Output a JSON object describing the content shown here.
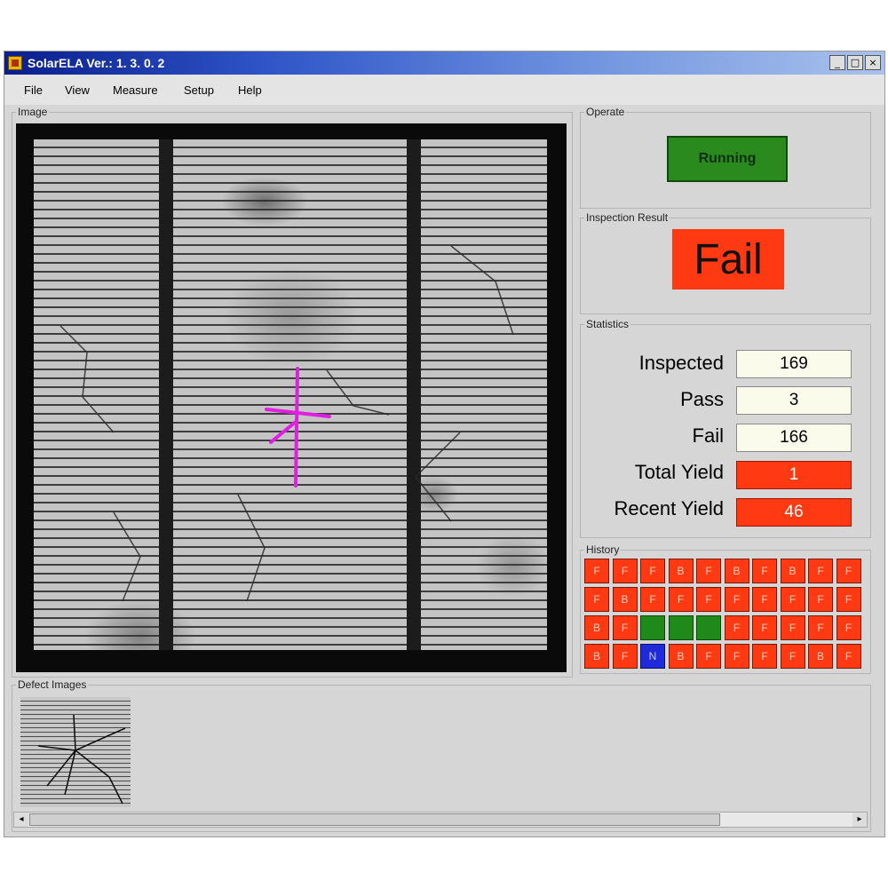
{
  "window": {
    "title": "SolarELA Ver.: 1. 3. 0. 2",
    "controls": {
      "minimize": "_",
      "maximize": "□",
      "close": "×"
    }
  },
  "menu": [
    "File",
    "View",
    "Measure",
    "Setup",
    "Help"
  ],
  "image_panel": {
    "label": "Image"
  },
  "operate": {
    "label": "Operate",
    "status_button": "Running",
    "status_color": "#2a8a1e"
  },
  "inspection_result": {
    "label": "Inspection Result",
    "value": "Fail",
    "color": "#ff3a12"
  },
  "statistics": {
    "label": "Statistics",
    "rows": [
      {
        "label": "Inspected",
        "value": "169",
        "style": "white"
      },
      {
        "label": "Pass",
        "value": "3",
        "style": "white"
      },
      {
        "label": "Fail",
        "value": "166",
        "style": "white"
      },
      {
        "label": "Total Yield",
        "value": "1",
        "style": "red"
      },
      {
        "label": "Recent Yield",
        "value": "46",
        "style": "red"
      }
    ]
  },
  "history": {
    "label": "History",
    "cells": [
      {
        "t": "F",
        "s": "fail"
      },
      {
        "t": "F",
        "s": "fail"
      },
      {
        "t": "F",
        "s": "fail"
      },
      {
        "t": "B",
        "s": "fail"
      },
      {
        "t": "F",
        "s": "fail"
      },
      {
        "t": "B",
        "s": "fail"
      },
      {
        "t": "F",
        "s": "fail"
      },
      {
        "t": "B",
        "s": "fail"
      },
      {
        "t": "F",
        "s": "fail"
      },
      {
        "t": "F",
        "s": "fail"
      },
      {
        "t": "F",
        "s": "fail"
      },
      {
        "t": "B",
        "s": "fail"
      },
      {
        "t": "F",
        "s": "fail"
      },
      {
        "t": "F",
        "s": "fail"
      },
      {
        "t": "F",
        "s": "fail"
      },
      {
        "t": "F",
        "s": "fail"
      },
      {
        "t": "F",
        "s": "fail"
      },
      {
        "t": "F",
        "s": "fail"
      },
      {
        "t": "F",
        "s": "fail"
      },
      {
        "t": "F",
        "s": "fail"
      },
      {
        "t": "B",
        "s": "fail"
      },
      {
        "t": "F",
        "s": "fail"
      },
      {
        "t": "",
        "s": "pass"
      },
      {
        "t": "",
        "s": "pass"
      },
      {
        "t": "",
        "s": "pass"
      },
      {
        "t": "F",
        "s": "fail"
      },
      {
        "t": "F",
        "s": "fail"
      },
      {
        "t": "F",
        "s": "fail"
      },
      {
        "t": "F",
        "s": "fail"
      },
      {
        "t": "F",
        "s": "fail"
      },
      {
        "t": "B",
        "s": "fail"
      },
      {
        "t": "F",
        "s": "fail"
      },
      {
        "t": "N",
        "s": "other"
      },
      {
        "t": "B",
        "s": "fail"
      },
      {
        "t": "F",
        "s": "fail"
      },
      {
        "t": "F",
        "s": "fail"
      },
      {
        "t": "F",
        "s": "fail"
      },
      {
        "t": "F",
        "s": "fail"
      },
      {
        "t": "B",
        "s": "fail"
      },
      {
        "t": "F",
        "s": "fail"
      }
    ]
  },
  "defect_images": {
    "label": "Defect Images"
  },
  "scrollbar": {
    "left_arrow": "◂",
    "right_arrow": "▸"
  },
  "icons": {
    "app": "app-icon",
    "defect_marker": "crosshair-marker-icon"
  },
  "colors": {
    "pass": "#1f8a1a",
    "fail": "#ff3a12",
    "other": "#1f2ad8",
    "marker": "#e020e0"
  }
}
